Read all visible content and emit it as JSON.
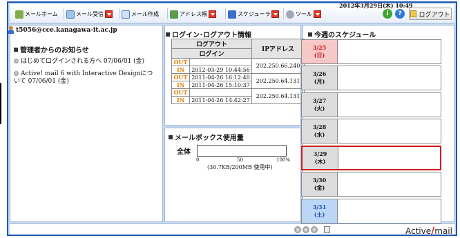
{
  "toolbar": {
    "items": [
      {
        "label": "メールホーム",
        "has_dropdown": false
      },
      {
        "label": "メール受信",
        "has_dropdown": true
      },
      {
        "label": "メール作成",
        "has_dropdown": false
      },
      {
        "label": "アドレス帳",
        "has_dropdown": true
      },
      {
        "label": "スケジューラ",
        "has_dropdown": true
      },
      {
        "label": "ツール",
        "has_dropdown": true
      }
    ],
    "info_icon": "i",
    "help_icon": "?",
    "logout_label": "ログアウト"
  },
  "user": {
    "email": "t5056@cce.kanagawa-it.ac.jp"
  },
  "notice": {
    "title": "管理者からのお知らせ",
    "items": [
      {
        "text": "はじめてログインされる方へ 07/06/01 (金)"
      },
      {
        "text": "Active! mail 6 with Interactive Designについて 07/06/01 (金)"
      }
    ]
  },
  "login_info": {
    "title": "ログイン･ログアウト情報",
    "header_logout": "ログアウト",
    "header_login": "ログイン",
    "header_ip": "IPアドレス",
    "records": [
      {
        "out_label": "OUT",
        "out_time": "",
        "in_label": "IN",
        "in_time": "2012-03-29 10:44:56",
        "ip": "202.250.66.240"
      },
      {
        "out_label": "OUT",
        "out_time": "2011-04-26 16:12:40",
        "in_label": "IN",
        "in_time": "2011-04-26 15:10:37",
        "ip": "202.250.64.131"
      },
      {
        "out_label": "OUT",
        "out_time": "",
        "in_label": "IN",
        "in_time": "2011-04-26 14:42:27",
        "ip": "202.250.64.131"
      }
    ]
  },
  "mailbox": {
    "title": "メールボックス使用量",
    "label": "全体",
    "tick_0": "0",
    "tick_50": "50",
    "tick_100": "100%",
    "usage_text": "(30.7KB/200MB 使用中)",
    "usage_fraction": 0.00015
  },
  "schedule": {
    "title": "今週のスケジュール",
    "days": [
      {
        "date": "3/25",
        "dow": "(日)",
        "color": "#f7c8c8",
        "text_color": "#d11b1b"
      },
      {
        "date": "3/26",
        "dow": "(月)",
        "color": "#dcdcdc",
        "text_color": "#111111"
      },
      {
        "date": "3/27",
        "dow": "(火)",
        "color": "#dcdcdc",
        "text_color": "#111111"
      },
      {
        "date": "3/28",
        "dow": "(水)",
        "color": "#dcdcdc",
        "text_color": "#111111"
      },
      {
        "date": "3/29",
        "dow": "(木)",
        "color": "#dcdcdc",
        "text_color": "#111111",
        "today": true
      },
      {
        "date": "3/30",
        "dow": "(金)",
        "color": "#dcdcdc",
        "text_color": "#111111"
      },
      {
        "date": "3/31",
        "dow": "(土)",
        "color": "#bcd6f5",
        "text_color": "#1b4fb8"
      }
    ]
  },
  "footer": {
    "datetime": "2012年3月29日(木) 10:49",
    "brand_a": "Active",
    "brand_slash": "/",
    "brand_b": "mail"
  },
  "colors": {
    "frame": "#1e56b4",
    "accent_orange": "#e37c00",
    "today_border": "#d11b1b"
  }
}
